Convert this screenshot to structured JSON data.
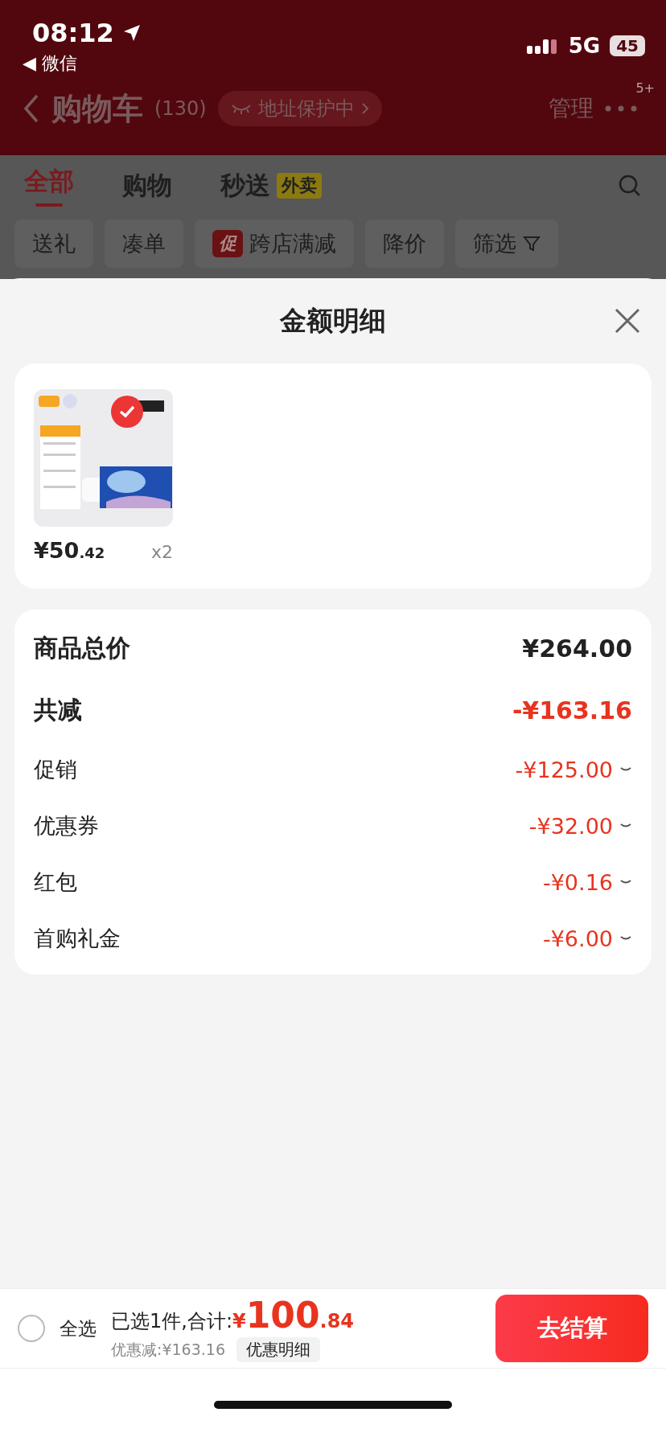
{
  "status_bar": {
    "time": "08:12",
    "back_app": "◀ 微信",
    "network": "5G",
    "battery": "45"
  },
  "header": {
    "title": "购物车",
    "count": "(130)",
    "protection": "地址保护中",
    "manage": "管理",
    "more_badge": "5+"
  },
  "tabs": [
    {
      "label": "全部",
      "selected": true
    },
    {
      "label": "购物",
      "selected": false
    },
    {
      "label": "秒送",
      "selected": false,
      "badge": "外卖"
    }
  ],
  "filters": [
    {
      "label": "送礼"
    },
    {
      "label": "凑单"
    },
    {
      "label": "跨店满减",
      "tag": "促"
    },
    {
      "label": "降价"
    },
    {
      "label": "筛选",
      "kind": "filter"
    }
  ],
  "sheet": {
    "title": "金额明细",
    "products": [
      {
        "kind": "picture",
        "checked": true,
        "price": "¥50",
        "price_decimal": ".42",
        "quantity": "x2"
      }
    ],
    "summary": [
      {
        "kind": "total",
        "label": "商品总价",
        "amount": "¥264.00"
      },
      {
        "kind": "discount_total",
        "label": "共减",
        "amount": "-¥163.16"
      },
      {
        "kind": "detail",
        "label": "促销",
        "amount": "-¥125.00",
        "expanded": false
      },
      {
        "kind": "detail",
        "label": "优惠券",
        "amount": "-¥32.00",
        "expanded": false
      },
      {
        "kind": "detail",
        "label": "红包",
        "amount": "-¥0.16",
        "expanded": false
      },
      {
        "kind": "detail",
        "label": "首购礼金",
        "amount": "-¥6.00",
        "expanded": false
      }
    ]
  },
  "footer": {
    "select_all": {
      "label": "全选",
      "checked": false
    },
    "selected_text": "已选1件,合计:",
    "currency": "¥",
    "total": "100",
    "total_decimal": ".84",
    "discount": "优惠减:¥163.16",
    "discount_detail": "优惠明细",
    "checkout": "去结算"
  }
}
